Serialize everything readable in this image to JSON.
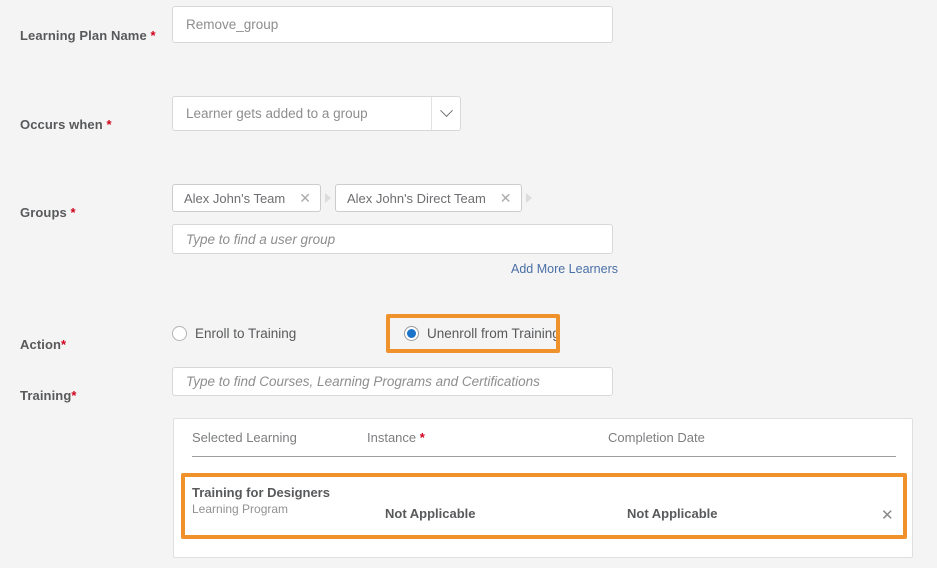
{
  "form": {
    "fields": {
      "plan_name": {
        "label": "Learning Plan Name",
        "required_mark": "*",
        "value": "Remove_group"
      },
      "occurs_when": {
        "label": "Occurs when",
        "required_mark": "*",
        "selected": "Learner gets added to a group",
        "icon": "chevron-down-icon"
      },
      "groups": {
        "label": "Groups",
        "required_mark": "*",
        "tags": [
          {
            "label": "Alex John's Team",
            "remove_icon": "close-icon"
          },
          {
            "label": "Alex John's Direct Team",
            "remove_icon": "close-icon"
          }
        ],
        "placeholder": "Type to find a user group",
        "add_more_link": "Add More Learners"
      },
      "action": {
        "label": "Action",
        "required_mark": "*",
        "options": [
          {
            "label": "Enroll to Training",
            "selected": false
          },
          {
            "label": "Unenroll from Training",
            "selected": true
          }
        ]
      },
      "training": {
        "label": "Training",
        "required_mark": "*",
        "placeholder": "Type to find Courses, Learning Programs and Certifications"
      }
    }
  },
  "table": {
    "headers": {
      "selected_learning": "Selected Learning",
      "instance": "Instance",
      "instance_required_mark": "*",
      "completion_date": "Completion Date"
    },
    "rows": [
      {
        "title": "Training for Designers",
        "subtitle": "Learning Program",
        "instance": "Not Applicable",
        "completion_date": "Not Applicable",
        "remove_icon": "close-icon"
      }
    ]
  },
  "colors": {
    "highlight": "#f0922b",
    "accent_link": "#4a6fa5",
    "radio_selected": "#1a73c8",
    "required": "#d0021b",
    "page_background": "#f4f4f4"
  }
}
